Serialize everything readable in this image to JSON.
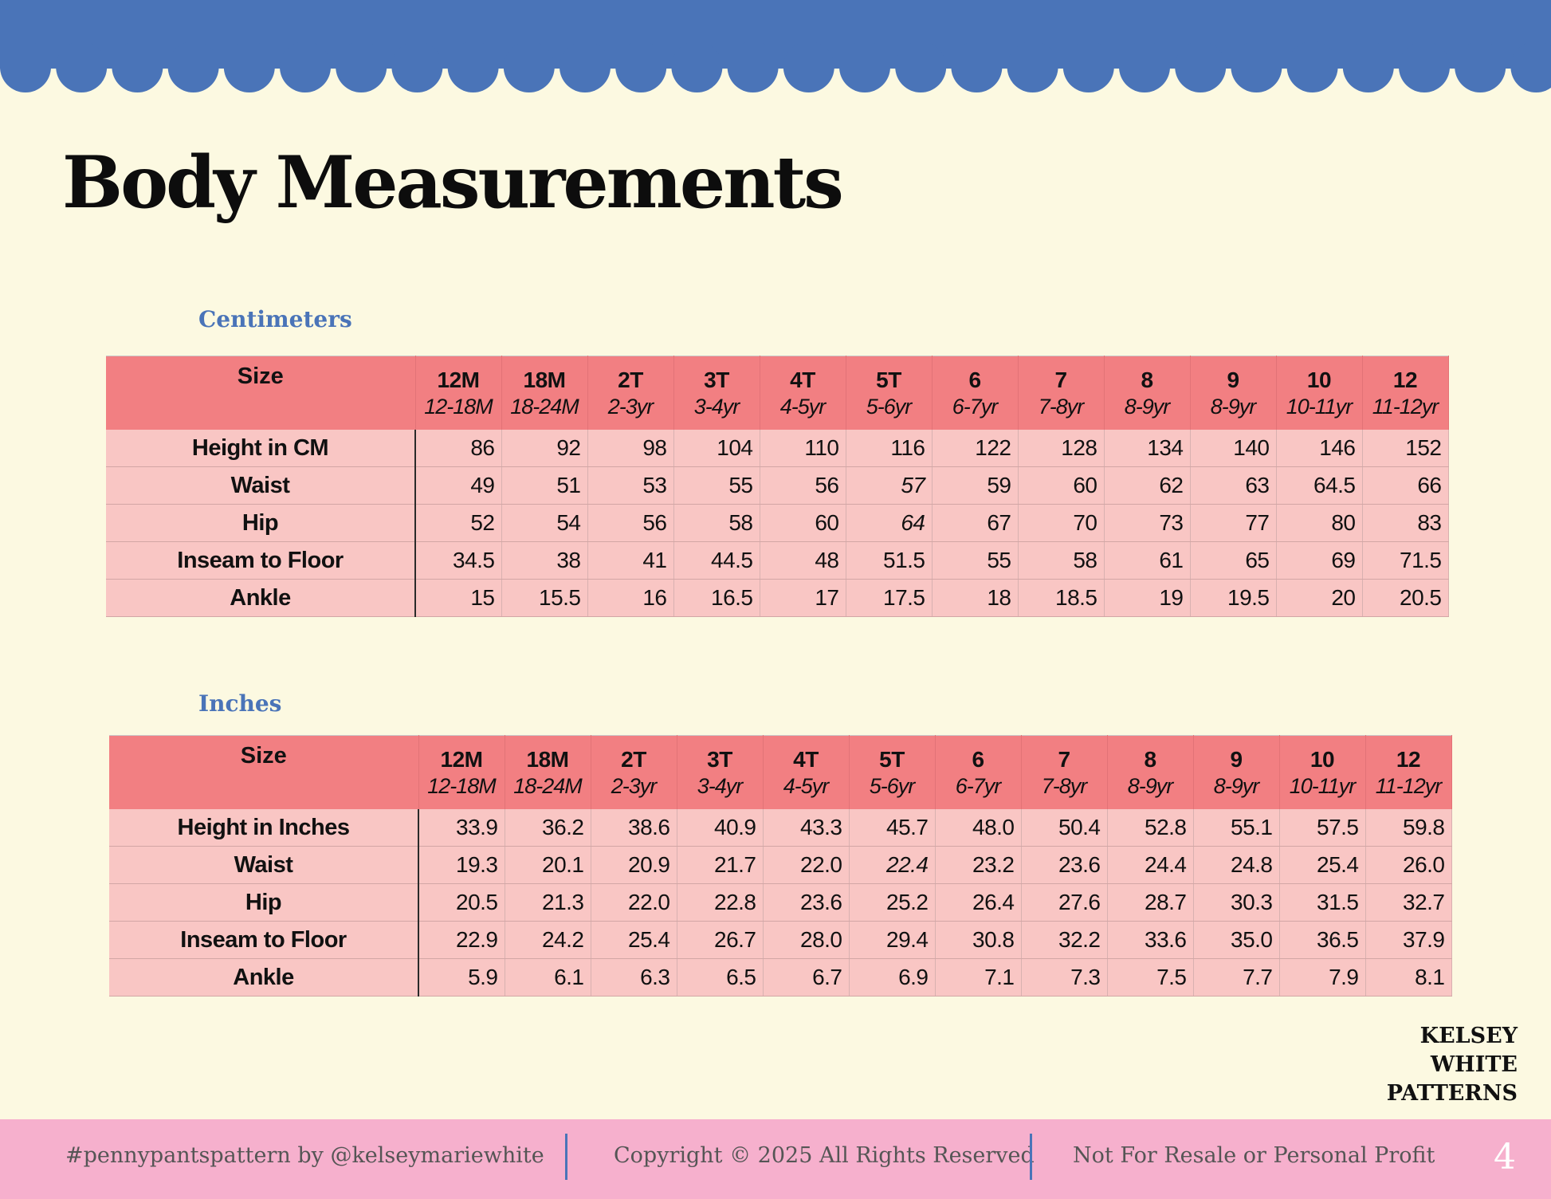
{
  "page": {
    "title": "Body Measurements",
    "background": "#fcf9e1",
    "accent_blue": "#4a74b8",
    "header_pink": "#f27f82",
    "body_pink": "#f9c6c4"
  },
  "size_header": "Size",
  "sizes": [
    {
      "size": "12M",
      "age": "12-18M"
    },
    {
      "size": "18M",
      "age": "18-24M"
    },
    {
      "size": "2T",
      "age": "2-3yr"
    },
    {
      "size": "3T",
      "age": "3-4yr"
    },
    {
      "size": "4T",
      "age": "4-5yr"
    },
    {
      "size": "5T",
      "age": "5-6yr"
    },
    {
      "size": "6",
      "age": "6-7yr"
    },
    {
      "size": "7",
      "age": "7-8yr"
    },
    {
      "size": "8",
      "age": "8-9yr"
    },
    {
      "size": "9",
      "age": "8-9yr"
    },
    {
      "size": "10",
      "age": "10-11yr"
    },
    {
      "size": "12",
      "age": "11-12yr"
    }
  ],
  "tables": [
    {
      "unit": "Centimeters",
      "rows": [
        {
          "label": "Height in CM",
          "values": [
            "86",
            "92",
            "98",
            "104",
            "110",
            "116",
            "122",
            "128",
            "134",
            "140",
            "146",
            "152"
          ]
        },
        {
          "label": "Waist",
          "values": [
            "49",
            "51",
            "53",
            "55",
            "56",
            "57",
            "59",
            "60",
            "62",
            "63",
            "64.5",
            "66"
          ]
        },
        {
          "label": "Hip",
          "values": [
            "52",
            "54",
            "56",
            "58",
            "60",
            "64",
            "67",
            "70",
            "73",
            "77",
            "80",
            "83"
          ]
        },
        {
          "label": "Inseam to Floor",
          "values": [
            "34.5",
            "38",
            "41",
            "44.5",
            "48",
            "51.5",
            "55",
            "58",
            "61",
            "65",
            "69",
            "71.5"
          ]
        },
        {
          "label": "Ankle",
          "values": [
            "15",
            "15.5",
            "16",
            "16.5",
            "17",
            "17.5",
            "18",
            "18.5",
            "19",
            "19.5",
            "20",
            "20.5"
          ]
        }
      ]
    },
    {
      "unit": "Inches",
      "rows": [
        {
          "label": "Height in Inches",
          "values": [
            "33.9",
            "36.2",
            "38.6",
            "40.9",
            "43.3",
            "45.7",
            "48.0",
            "50.4",
            "52.8",
            "55.1",
            "57.5",
            "59.8"
          ]
        },
        {
          "label": "Waist",
          "values": [
            "19.3",
            "20.1",
            "20.9",
            "21.7",
            "22.0",
            "22.4",
            "23.2",
            "23.6",
            "24.4",
            "24.8",
            "25.4",
            "26.0"
          ]
        },
        {
          "label": "Hip",
          "values": [
            "20.5",
            "21.3",
            "22.0",
            "22.8",
            "23.6",
            "25.2",
            "26.4",
            "27.6",
            "28.7",
            "30.3",
            "31.5",
            "32.7"
          ]
        },
        {
          "label": "Inseam to Floor",
          "values": [
            "22.9",
            "24.2",
            "25.4",
            "26.7",
            "28.0",
            "29.4",
            "30.8",
            "32.2",
            "33.6",
            "35.0",
            "36.5",
            "37.9"
          ]
        },
        {
          "label": "Ankle",
          "values": [
            "5.9",
            "6.1",
            "6.3",
            "6.5",
            "6.7",
            "6.9",
            "7.1",
            "7.3",
            "7.5",
            "7.7",
            "7.9",
            "8.1"
          ]
        }
      ]
    }
  ],
  "brand": {
    "line1": "KELSEY",
    "line2": "WHITE",
    "line3": "PATTERNS"
  },
  "footer": {
    "hashtag": "#pennypantspattern by @kelseymariewhite",
    "copyright": "Copyright © 2025 All Rights Reserved",
    "notice": "Not For Resale or Personal Profit",
    "page_number": "4"
  }
}
